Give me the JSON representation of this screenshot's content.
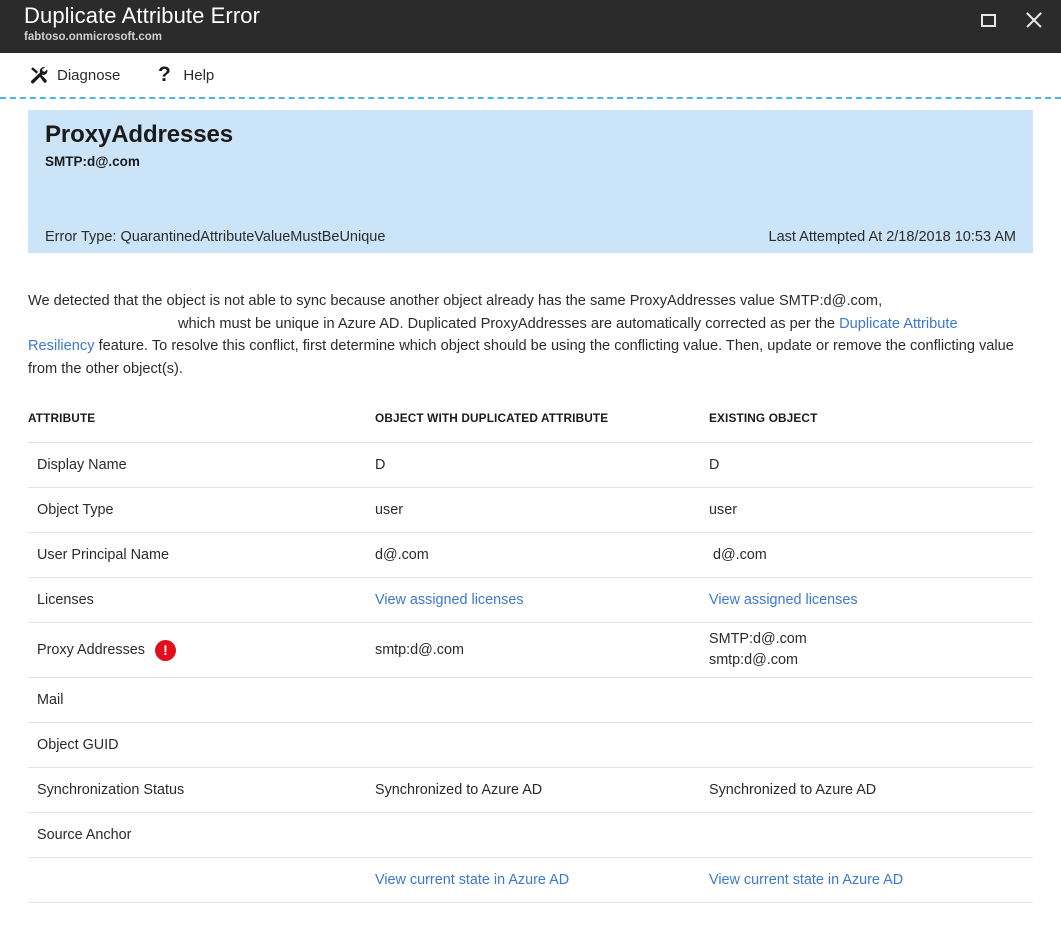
{
  "window": {
    "title": "Duplicate Attribute Error",
    "subtitle": "fabtoso.onmicrosoft.com",
    "restore_label": "restore",
    "close_label": "close"
  },
  "toolbar": {
    "items": [
      {
        "label": "Diagnose",
        "icon": "tools-icon"
      },
      {
        "label": "Help",
        "icon": "question-mark-icon"
      }
    ]
  },
  "banner": {
    "attribute_name": "ProxyAddresses",
    "attribute_value": "SMTP:d@.com",
    "error_type": "Error Type: QuarantinedAttributeValueMustBeUnique",
    "last_attempted": "Last Attempted At 2/18/2018 10:53 AM",
    "background_color": "#CCE4F7"
  },
  "description": {
    "part1": "We detected that the object is not able to sync because another object already has the same ProxyAddresses value SMTP:d@.com,",
    "part2": "which must be unique in Azure AD. Duplicated ProxyAddresses are automatically corrected as per the",
    "link_text": "Duplicate Attribute Resiliency",
    "part3": "feature. To resolve this conflict, first determine which object should be using the conflicting value. Then, update or remove the conflicting value from the other object(s)."
  },
  "table": {
    "headers": [
      "ATTRIBUTE",
      "OBJECT WITH DUPLICATED ATTRIBUTE",
      "EXISTING OBJECT"
    ],
    "rows": [
      {
        "attribute": "Display Name",
        "duplicated": "D",
        "existing": "D",
        "error": false
      },
      {
        "attribute": "Object Type",
        "duplicated": "user",
        "existing": "user",
        "error": false
      },
      {
        "attribute": "User Principal Name",
        "duplicated": "d@.com",
        "existing": "d@.com",
        "error": false
      },
      {
        "attribute": "Licenses",
        "duplicated": "View assigned licenses",
        "existing": "View assigned licenses",
        "error": false,
        "link": true
      },
      {
        "attribute": "Proxy Addresses",
        "duplicated": "smtp:d@.com",
        "existing": "SMTP:d@.com\nsmtp:d@.com",
        "error": true
      },
      {
        "attribute": "Mail",
        "duplicated": "",
        "existing": "",
        "error": false
      },
      {
        "attribute": "Object GUID",
        "duplicated": "",
        "existing": "",
        "error": false
      },
      {
        "attribute": "Synchronization Status",
        "duplicated": "Synchronized to Azure AD",
        "existing": "Synchronized to Azure AD",
        "error": false
      },
      {
        "attribute": "Source Anchor",
        "duplicated": "",
        "existing": "",
        "error": false
      },
      {
        "attribute": "",
        "duplicated": "View current state in Azure AD",
        "existing": "View current state in Azure AD",
        "error": false,
        "link": true
      }
    ]
  },
  "colors": {
    "titlebar": "#2B2B2B",
    "accent_link": "#3B78CF",
    "error_red": "#E10F1C",
    "divider_blue": "#4FB3E8"
  }
}
